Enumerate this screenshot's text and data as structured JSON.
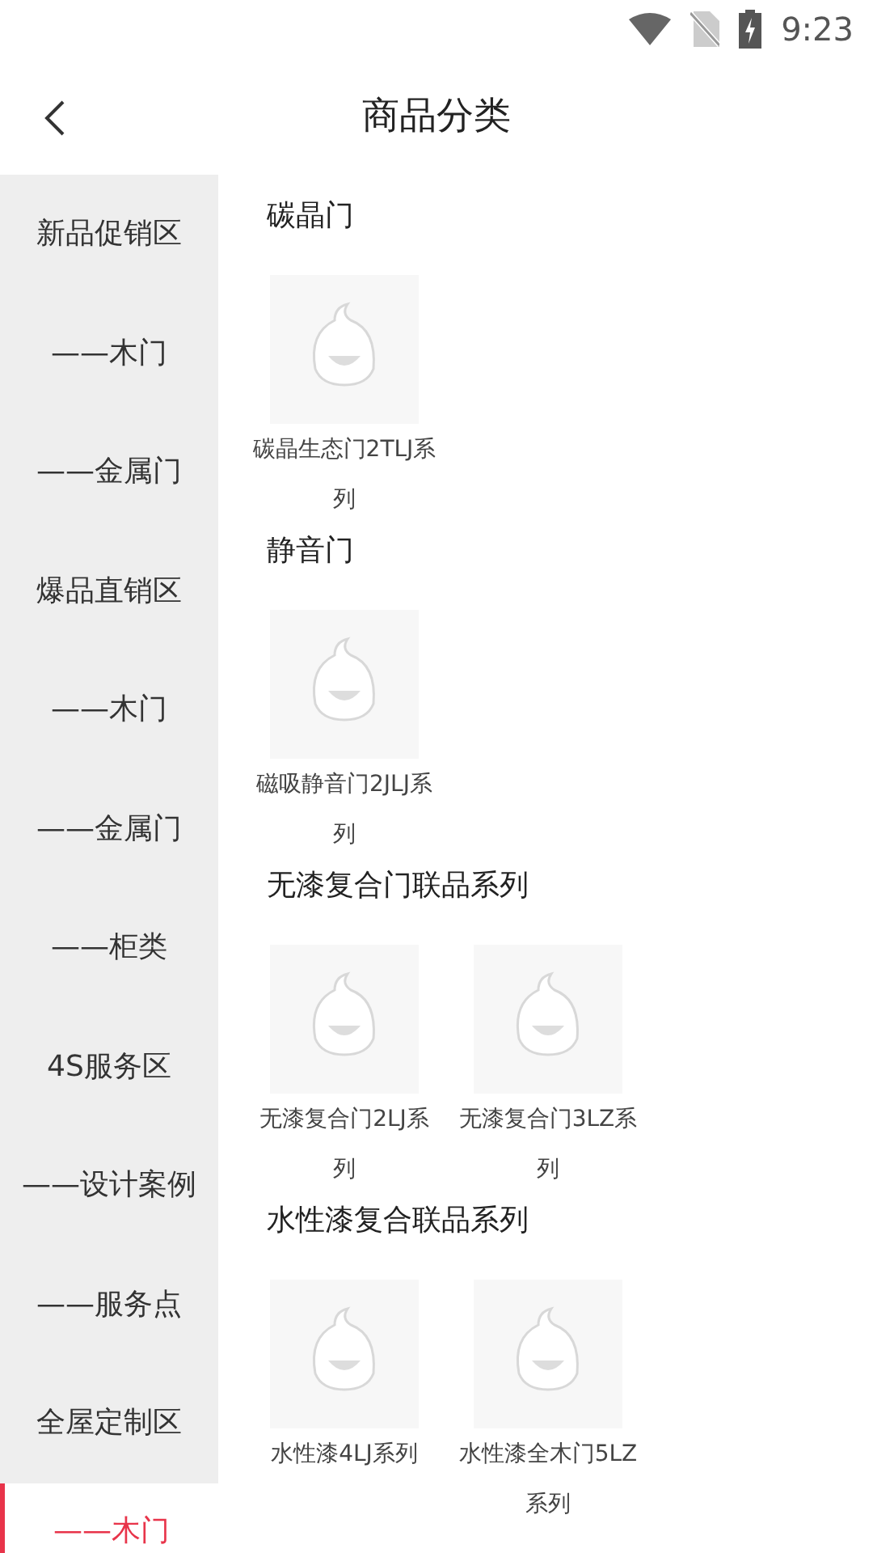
{
  "status_bar": {
    "time": "9:23"
  },
  "header": {
    "title": "商品分类"
  },
  "sidebar": {
    "items": [
      {
        "label": "新品促销区",
        "selected": false
      },
      {
        "label": "——木门",
        "selected": false
      },
      {
        "label": "——金属门",
        "selected": false
      },
      {
        "label": "爆品直销区",
        "selected": false
      },
      {
        "label": "——木门",
        "selected": false
      },
      {
        "label": "——金属门",
        "selected": false
      },
      {
        "label": "——柜类",
        "selected": false
      },
      {
        "label": "4S服务区",
        "selected": false
      },
      {
        "label": "——设计案例",
        "selected": false
      },
      {
        "label": "——服务点",
        "selected": false
      },
      {
        "label": "全屋定制区",
        "selected": false
      },
      {
        "label": "——木门",
        "selected": true
      }
    ]
  },
  "sections": [
    {
      "title": "碳晶门",
      "products": [
        {
          "name": "碳晶生态门2TLJ系列"
        }
      ]
    },
    {
      "title": "静音门",
      "products": [
        {
          "name": "磁吸静音门2JLJ系列"
        }
      ]
    },
    {
      "title": "无漆复合门联品系列",
      "products": [
        {
          "name": "无漆复合门2LJ系列"
        },
        {
          "name": "无漆复合门3LZ系列"
        }
      ]
    },
    {
      "title": "水性漆复合联品系列",
      "products": [
        {
          "name": "水性漆4LJ系列"
        },
        {
          "name": "水性漆全木门5LZ系列"
        }
      ]
    }
  ]
}
